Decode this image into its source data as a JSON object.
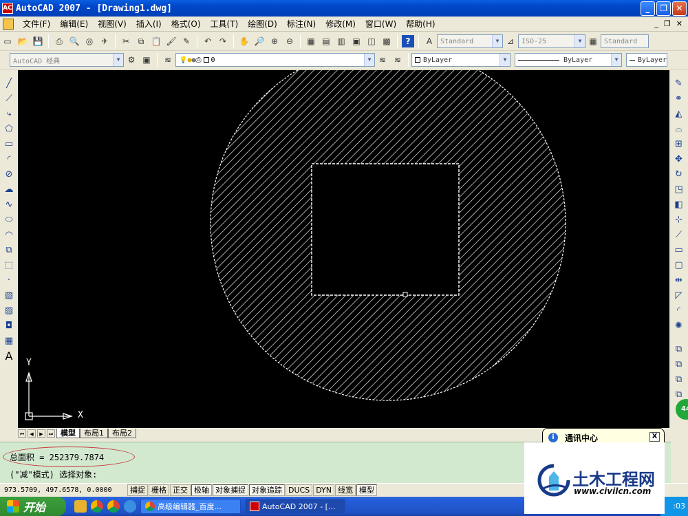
{
  "window": {
    "title": "AutoCAD 2007 - [Drawing1.dwg]",
    "app_icon_text": "AC"
  },
  "menu": {
    "items": [
      "文件(F)",
      "编辑(E)",
      "视图(V)",
      "插入(I)",
      "格式(O)",
      "工具(T)",
      "绘图(D)",
      "标注(N)",
      "修改(M)",
      "窗口(W)",
      "帮助(H)"
    ]
  },
  "toolbar": {
    "text_style": "Standard",
    "dim_style": "ISO-25",
    "table_style": "Standard",
    "workspace": "AutoCAD 经典",
    "layer": "0",
    "color": "ByLayer",
    "linetype": "ByLayer",
    "lineweight": "ByLayer"
  },
  "ucs": {
    "x_label": "X",
    "y_label": "Y"
  },
  "layout_tabs": [
    {
      "label": "模型",
      "active": true
    },
    {
      "label": "布局1",
      "active": false
    },
    {
      "label": "布局2",
      "active": false
    }
  ],
  "command": {
    "line1": "总面积 = 252379.7874",
    "line2": "(\"减\"模式) 选择对象:"
  },
  "status": {
    "coords": "973.5709,  497.6578, 0.0000",
    "buttons": [
      {
        "label": "捕捉",
        "on": false
      },
      {
        "label": "栅格",
        "on": false
      },
      {
        "label": "正交",
        "on": false
      },
      {
        "label": "极轴",
        "on": true
      },
      {
        "label": "对象捕捉",
        "on": true
      },
      {
        "label": "对象追踪",
        "on": true
      },
      {
        "label": "DUCS",
        "on": false
      },
      {
        "label": "DYN",
        "on": false
      },
      {
        "label": "线宽",
        "on": false
      },
      {
        "label": "模型",
        "on": true
      }
    ]
  },
  "taskbar": {
    "start_label": "开始",
    "items": [
      {
        "label": "高级编辑器_百度...",
        "active": false
      },
      {
        "label": "AutoCAD 2007 - [...",
        "active": true
      }
    ],
    "clock": ":03"
  },
  "notification": {
    "title": "通讯中心",
    "close": "X"
  },
  "watermark": {
    "title": "土木工程网",
    "url": "www.civilcn.com"
  },
  "badge": "44",
  "colors": {
    "canvas_bg": "#000000",
    "hatch": "#ffffff",
    "command_bg": "#d2e9d0",
    "ellipse": "#c83c3c"
  }
}
